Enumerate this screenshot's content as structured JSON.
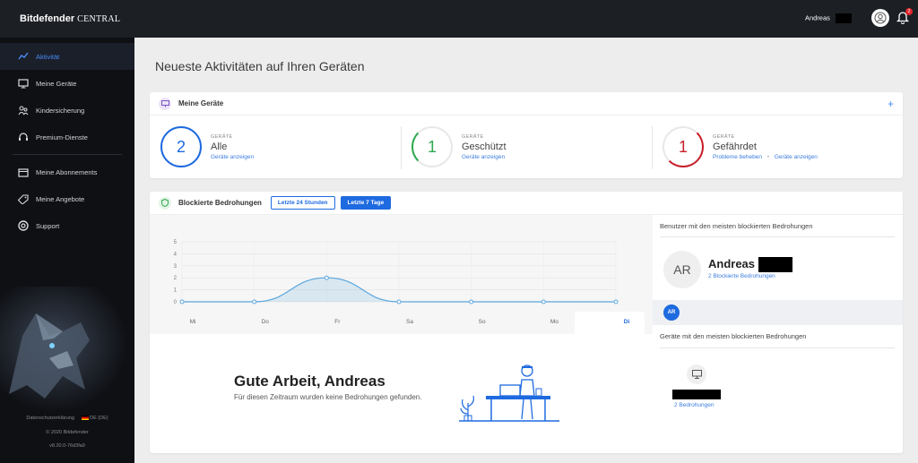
{
  "brand": {
    "name": "Bitdefender",
    "suffix": "CENTRAL"
  },
  "sidebar": {
    "items": [
      {
        "label": "Aktivität",
        "icon": "activity-icon",
        "active": true
      },
      {
        "label": "Meine Geräte",
        "icon": "monitor-icon"
      },
      {
        "label": "Kindersicherung",
        "icon": "family-icon"
      },
      {
        "label": "Premium-Dienste",
        "icon": "headset-icon"
      },
      {
        "label": "Meine Abonnements",
        "icon": "calendar-icon"
      },
      {
        "label": "Meine Angebote",
        "icon": "tag-icon"
      },
      {
        "label": "Support",
        "icon": "lifebuoy-icon"
      }
    ],
    "footer": {
      "privacy": "Datenschutzerklärung",
      "language": "DE (DE)",
      "copyright": "© 2020 Bitdefender",
      "version": "v8.20.0-76d3fa9"
    }
  },
  "topbar": {
    "user": "Andreas",
    "notifications": "2"
  },
  "page": {
    "title": "Neueste Aktivitäten auf Ihren Geräten"
  },
  "devices_card": {
    "title": "Meine Geräte",
    "stats": [
      {
        "count": "2",
        "caption": "GERÄTE",
        "label": "Alle",
        "links": [
          "Geräte anzeigen"
        ],
        "color": "#1e6ae0"
      },
      {
        "count": "1",
        "caption": "GERÄTE",
        "label": "Geschützt",
        "links": [
          "Geräte anzeigen"
        ],
        "color": "#2fa84f"
      },
      {
        "count": "1",
        "caption": "GERÄTE",
        "label": "Gefährdet",
        "links": [
          "Probleme beheben",
          "Geräte anzeigen"
        ],
        "color": "#c8202b"
      }
    ]
  },
  "threats_card": {
    "title": "Blockierte Bedrohungen",
    "tabs": [
      "Letzte 24 Stunden",
      "Letzte 7 Tage"
    ],
    "active_tab": "Letzte 7 Tage",
    "message_title": "Gute Arbeit, Andreas",
    "message_body": "Für diesen Zeitraum wurden keine Bedrohungen gefunden.",
    "top_users_title": "Benutzer mit den meisten blockierten Bedrohungen",
    "top_user": {
      "initials": "AR",
      "name": "Andreas",
      "threats": "2 Blockierte Bedrohungen"
    },
    "top_devices_title": "Geräte mit den meisten blockierten Bedrohungen",
    "top_device": {
      "threats": "2 Bedrohungen"
    }
  },
  "chart_data": {
    "type": "area",
    "categories": [
      "Mi",
      "Do",
      "Fr",
      "Sa",
      "So",
      "Mo",
      "Di"
    ],
    "values": [
      0,
      0,
      2,
      0,
      0,
      0,
      0
    ],
    "ylim": [
      0,
      5
    ],
    "yticks": [
      "0",
      "1",
      "2",
      "3",
      "4",
      "5"
    ],
    "active_category": "Di",
    "grid": true,
    "color": "#5aa7dd"
  }
}
